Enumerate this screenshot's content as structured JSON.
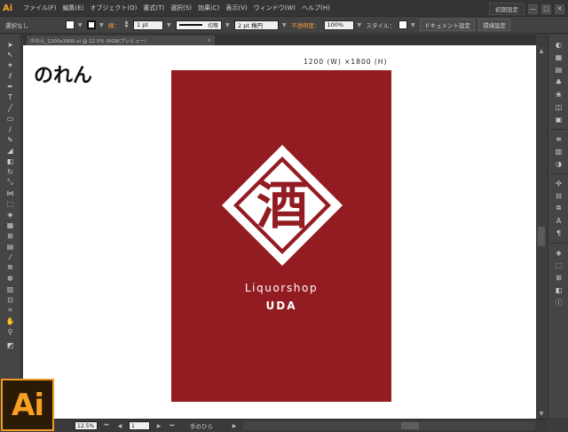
{
  "app": {
    "logo_text": "Ai",
    "badge_text": "Ai",
    "accent_color": "#f29b24"
  },
  "menu": {
    "items": [
      "ファイル(F)",
      "編集(E)",
      "オブジェクト(O)",
      "書式(T)",
      "選択(S)",
      "効果(C)",
      "表示(V)",
      "ウィンドウ(W)",
      "ヘルプ(H)"
    ],
    "workspace": "初期設定",
    "window_buttons": [
      "—",
      "□",
      "✕"
    ]
  },
  "control_bar": {
    "selection_label": "選択なし",
    "stroke_label": "線：",
    "stroke_weight": "1 pt",
    "stroke_profile": "均等",
    "brush": "2 pt 楕円",
    "opacity_label": "不透明度：",
    "opacity_value": "100%",
    "style_label": "スタイル：",
    "doc_settings_button": "ドキュメント設定",
    "preferences_button": "環境設定"
  },
  "document_tab": {
    "name": "のれん_1200x1800.ai @ 12.5% (RGB/プレビュー)"
  },
  "artboard": {
    "title": "のれん",
    "size_label": "1200 (W) ×1800 (H)",
    "noren_color": "#921c22",
    "emblem_glyph": "酒",
    "brand_name": "Liquorshop",
    "brand_sub": "UDA"
  },
  "status_bar": {
    "zoom": "12.5%",
    "page": "1",
    "tool_label": "手のひら"
  }
}
